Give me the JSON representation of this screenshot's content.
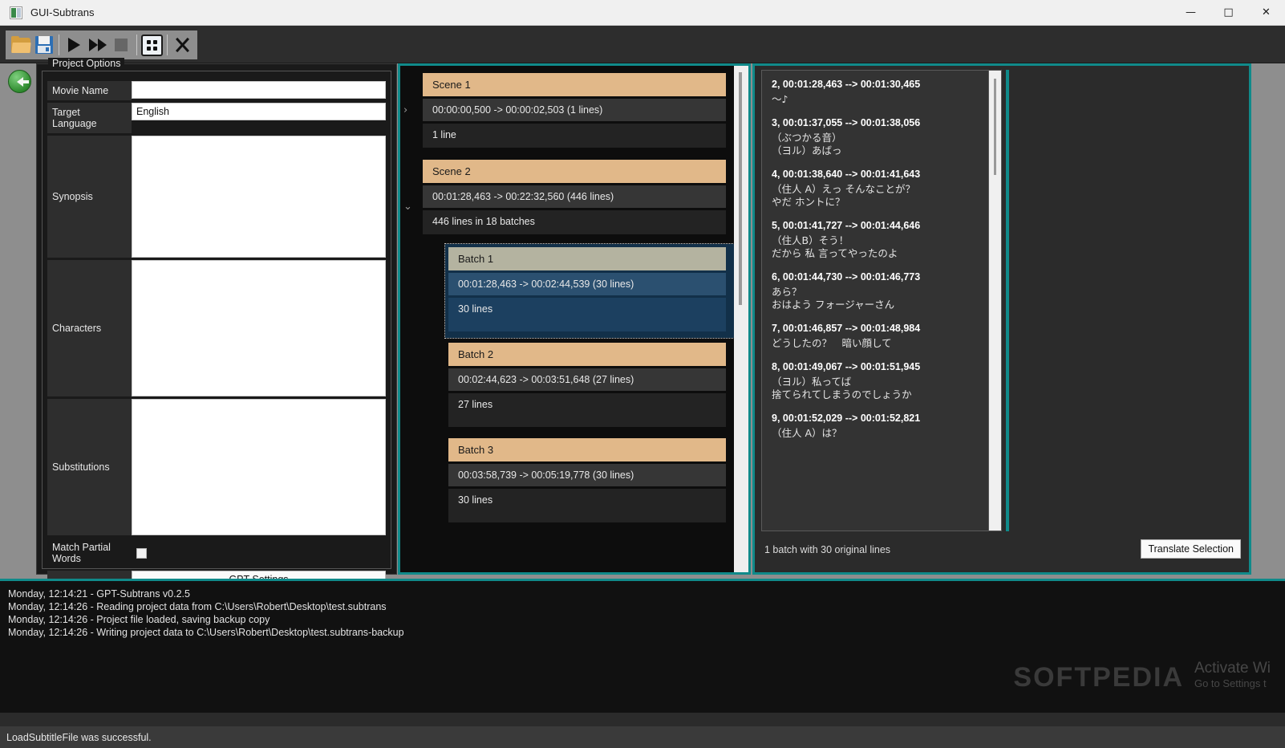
{
  "window": {
    "title": "GUI-Subtrans",
    "icon": "app-icon",
    "controls": {
      "minimize": "—",
      "maximize": "□",
      "close": "✕"
    }
  },
  "toolbar": {
    "buttons": [
      {
        "name": "open-project",
        "icon": "folder-icon",
        "label": "Open"
      },
      {
        "name": "save-project",
        "icon": "save-icon",
        "label": "Save"
      },
      {
        "name": "start-translating",
        "icon": "play-icon",
        "label": "Start Translating"
      },
      {
        "name": "start-translating-fast",
        "icon": "fast-forward-icon",
        "label": "Start Translating Fast"
      },
      {
        "name": "stop-translating",
        "icon": "stop-icon",
        "label": "Stop"
      },
      {
        "name": "toggle-project-options",
        "icon": "grid-icon",
        "label": "Project Settings"
      },
      {
        "name": "quit",
        "icon": "close-x-icon",
        "label": "Quit"
      }
    ]
  },
  "navigation": {
    "back_label": "Back",
    "back_icon": "back-arrow-icon"
  },
  "project_options": {
    "group_title": "Project Options",
    "fields": [
      {
        "label": "Movie Name",
        "value": "",
        "placeholder": ""
      },
      {
        "label": "Target Language",
        "value": "English",
        "placeholder": ""
      },
      {
        "label": "Synopsis",
        "value": "",
        "placeholder": ""
      },
      {
        "label": "Characters",
        "value": "",
        "placeholder": ""
      },
      {
        "label": "Substitutions",
        "value": "",
        "placeholder": ""
      }
    ],
    "match_partial_words": {
      "label": "Match Partial Words",
      "checked": false
    },
    "gpt_settings_label": "GPT Settings"
  },
  "scenes": [
    {
      "title": "Scene 1",
      "range": "00:00:00,500 -> 00:00:02,503 (1 lines)",
      "summary": "1 line",
      "expander": "›",
      "expanded": false,
      "batches": []
    },
    {
      "title": "Scene 2",
      "range": "00:01:28,463 -> 00:22:32,560 (446 lines)",
      "summary": "446 lines in 18 batches",
      "expander": "⌄",
      "expanded": true,
      "batches": [
        {
          "title": "Batch 1",
          "range": "00:01:28,463 -> 00:02:44,539 (30 lines)",
          "summary": "30 lines",
          "selected": true
        },
        {
          "title": "Batch 2",
          "range": "00:02:44,623 -> 00:03:51,648 (27 lines)",
          "summary": "27 lines",
          "selected": false
        },
        {
          "title": "Batch 3",
          "range": "00:03:58,739 -> 00:05:19,778 (30 lines)",
          "summary": "30 lines",
          "selected": false
        }
      ]
    }
  ],
  "subtitles": [
    {
      "time": "2, 00:01:28,463 --> 00:01:30,465",
      "text": "〜♪"
    },
    {
      "time": "3, 00:01:37,055 --> 00:01:38,056",
      "text": "（ぶつかる音）\n（ヨル）あばっ"
    },
    {
      "time": "4, 00:01:38,640 --> 00:01:41,643",
      "text": "（住人 A）えっ そんなことが？\nやだ ホントに？"
    },
    {
      "time": "5, 00:01:41,727 --> 00:01:44,646",
      "text": "（住人B）そう！\nだから 私 言ってやったのよ"
    },
    {
      "time": "6, 00:01:44,730 --> 00:01:46,773",
      "text": "あら？\nおはよう フォージャーさん"
    },
    {
      "time": "7, 00:01:46,857 --> 00:01:48,984",
      "text": "どうしたの？　暗い顔して"
    },
    {
      "time": "8, 00:01:49,067 --> 00:01:51,945",
      "text": "（ヨル）私ってば\n捨てられてしまうのでしょうか"
    },
    {
      "time": "9, 00:01:52,029 --> 00:01:52,821",
      "text": "（住人 A）は？"
    }
  ],
  "selection": {
    "status": "1 batch with 30 original lines",
    "translate_button": "Translate Selection"
  },
  "log": [
    "Monday, 12:14:21 - GPT-Subtrans v0.2.5",
    "Monday, 12:14:26 - Reading project data from C:\\Users\\Robert\\Desktop\\test.subtrans",
    "Monday, 12:14:26 - Project file loaded, saving backup copy",
    "Monday, 12:14:26 - Writing project data to C:\\Users\\Robert\\Desktop\\test.subtrans-backup"
  ],
  "statusbar": {
    "message": "LoadSubtitleFile was successful."
  },
  "watermarks": {
    "softpedia": "SOFTPEDIA",
    "activate_line1": "Activate Wi",
    "activate_line2": "Go to Settings t"
  },
  "colors": {
    "accent_teal": "#108a8a",
    "scene_header": "#e1b889",
    "batch_selected_header": "#b4b3a0",
    "batch_selected_bg": "#123049",
    "panel_bg": "#1a1a1a"
  }
}
